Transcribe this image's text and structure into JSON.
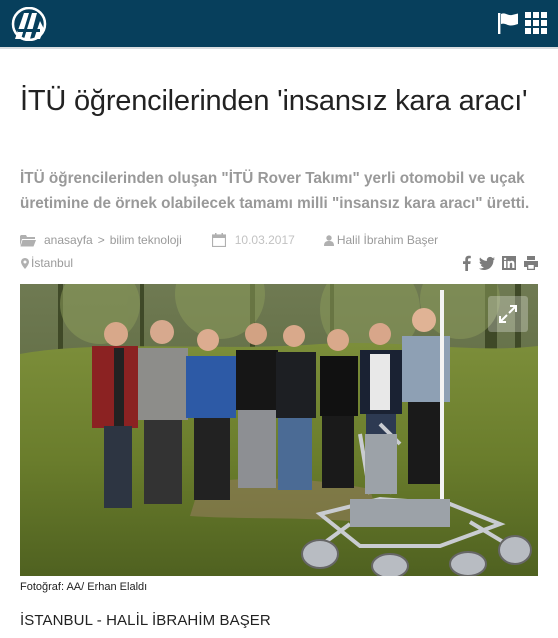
{
  "header": {
    "logo_alt": "AA",
    "flag_icon": "flag-icon",
    "menu_icon": "grid-menu-icon",
    "bg_color": "#073f5c"
  },
  "article": {
    "title": "İTÜ öğrencilerinden 'insansız kara aracı'",
    "lead": "İTÜ öğrencilerinden oluşan \"İTÜ Rover Takımı\" yerli otomobil ve uçak üretimine de örnek olabilecek tamamı milli \"insansız kara aracı\" üretti.",
    "breadcrumb": [
      "anasayfa",
      "bilim teknoloji"
    ],
    "breadcrumb_sep": ">",
    "date": "10.03.2017",
    "author": "Halil İbrahim Başer",
    "location": "İstanbul",
    "share_icons": [
      "facebook-icon",
      "twitter-icon",
      "linkedin-icon",
      "print-icon"
    ],
    "photo_caption": "Fotoğraf: AA/ Erhan Elaldı",
    "dateline": "İSTANBUL - HALİL İBRAHİM BAŞER"
  }
}
